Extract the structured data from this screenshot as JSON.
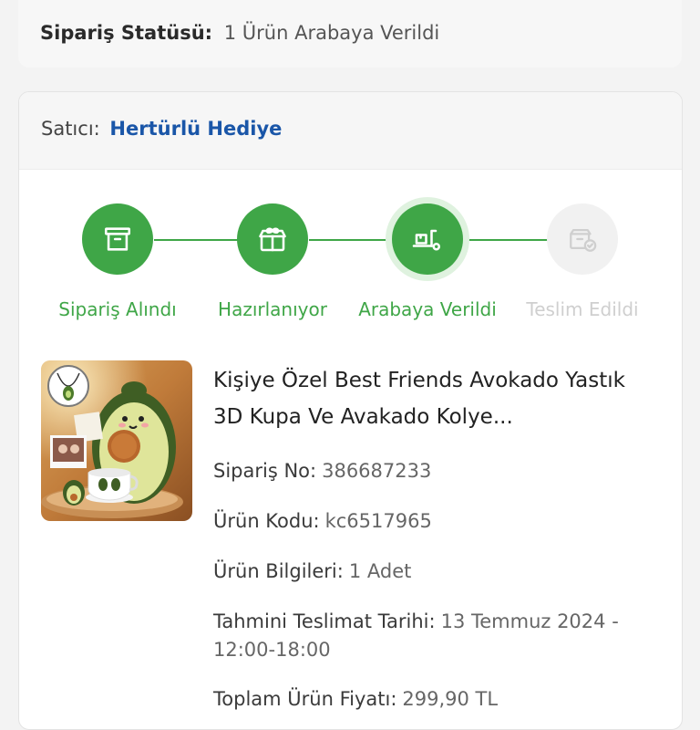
{
  "order_status": {
    "label": "Sipariş Statüsü:",
    "value": "1 Ürün Arabaya Verildi"
  },
  "seller": {
    "label": "Satıcı:",
    "name": "Hertürlü Hediye"
  },
  "steps": [
    {
      "label": "Sipariş Alındı",
      "state": "done",
      "icon": "archive-box-icon"
    },
    {
      "label": "Hazırlanıyor",
      "state": "done",
      "icon": "gift-box-icon"
    },
    {
      "label": "Arabaya Verildi",
      "state": "active",
      "icon": "delivery-hand-truck-icon"
    },
    {
      "label": "Teslim Edildi",
      "state": "pending",
      "icon": "delivered-box-check-icon"
    }
  ],
  "colors": {
    "accent_green": "#3fa647",
    "seller_link": "#1a56a8",
    "pending_gray": "#cfcfcf"
  },
  "product": {
    "title": "Kişiye Özel Best Friends Avokado Yastık 3D Kupa Ve Avakado Kolye...",
    "order_no_label": "Sipariş No:",
    "order_no": "386687233",
    "product_code_label": "Ürün Kodu:",
    "product_code": "kc6517965",
    "info_label": "Ürün Bilgileri:",
    "info": "1 Adet",
    "delivery_label": "Tahmini Teslimat Tarihi:",
    "delivery": "13 Temmuz 2024 - 12:00-18:00",
    "total_label": "Toplam Ürün Fiyatı:",
    "total": "299,90 TL"
  }
}
